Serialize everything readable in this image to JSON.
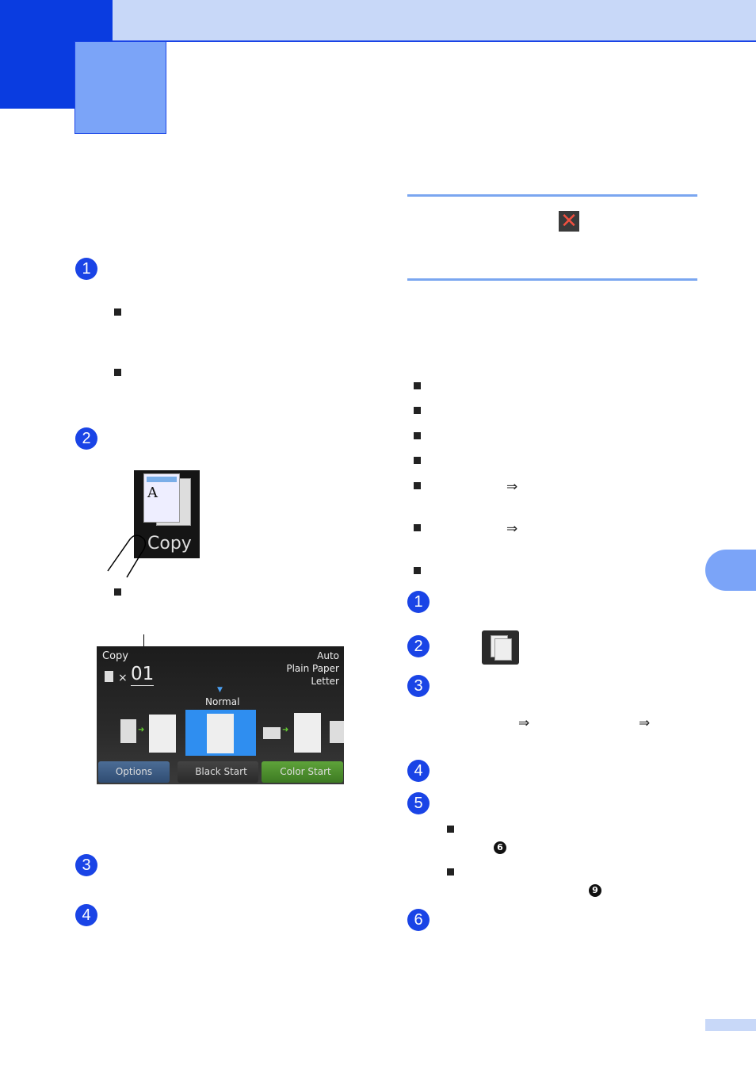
{
  "header": {
    "accent": "#1a44e6",
    "band": "#c8d8f8",
    "tab": "#7ba4f8"
  },
  "steps_left": [
    "1",
    "2",
    "3",
    "4"
  ],
  "steps_right": [
    "1",
    "2",
    "3",
    "4",
    "5",
    "6"
  ],
  "copy_icon": {
    "label": "Copy"
  },
  "lcd": {
    "title": "Copy",
    "count_prefix": "×",
    "count": "01",
    "tray": "Auto",
    "paper_type": "Plain Paper",
    "paper_size": "Letter",
    "mode": "Normal",
    "options": "Options",
    "black_start": "Black Start",
    "color_start": "Color Start"
  },
  "arrows": [
    "⇒",
    "⇒",
    "⇒",
    "⇒"
  ],
  "refs": [
    "6",
    "9"
  ]
}
